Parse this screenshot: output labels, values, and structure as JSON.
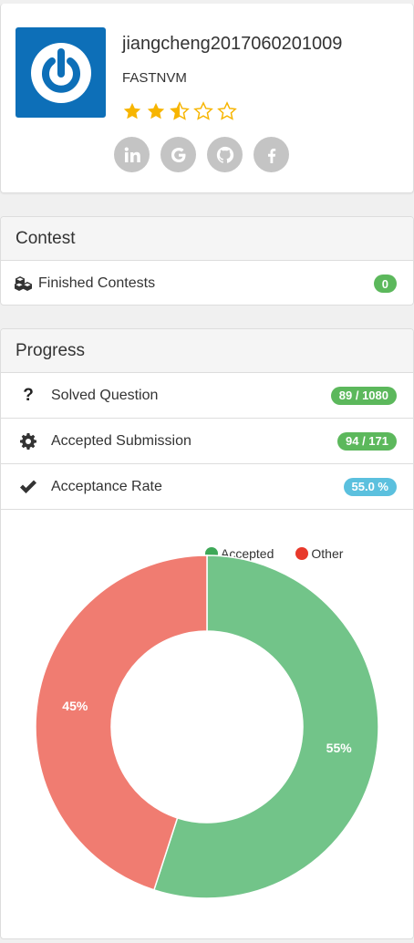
{
  "profile": {
    "username": "jiangcheng2017060201009",
    "subtitle": "FASTNVM",
    "rating_stars": 2.5,
    "max_stars": 5,
    "socials": [
      "linkedin-icon",
      "google-icon",
      "github-icon",
      "facebook-icon"
    ]
  },
  "contest": {
    "title": "Contest",
    "items": [
      {
        "label": "Finished Contests",
        "value": "0"
      }
    ]
  },
  "progress": {
    "title": "Progress",
    "items": [
      {
        "label": "Solved Question",
        "value": "89 / 1080"
      },
      {
        "label": "Accepted Submission",
        "value": "94 / 171"
      },
      {
        "label": "Acceptance Rate",
        "value": "55.0 %"
      }
    ]
  },
  "colors": {
    "avatar_bg": "#0d6fb8",
    "badge_green": "#5cb85c",
    "badge_blue": "#5bc0de",
    "star": "#f7b500",
    "accepted": "#72c489",
    "other": "#f07c71",
    "legend_accepted": "#3ea858",
    "legend_other": "#e8392b"
  },
  "chart_data": {
    "type": "pie",
    "series": [
      {
        "name": "Accepted",
        "value": 55,
        "label": "55%"
      },
      {
        "name": "Other",
        "value": 45,
        "label": "45%"
      }
    ],
    "legend_position": "top-right"
  }
}
